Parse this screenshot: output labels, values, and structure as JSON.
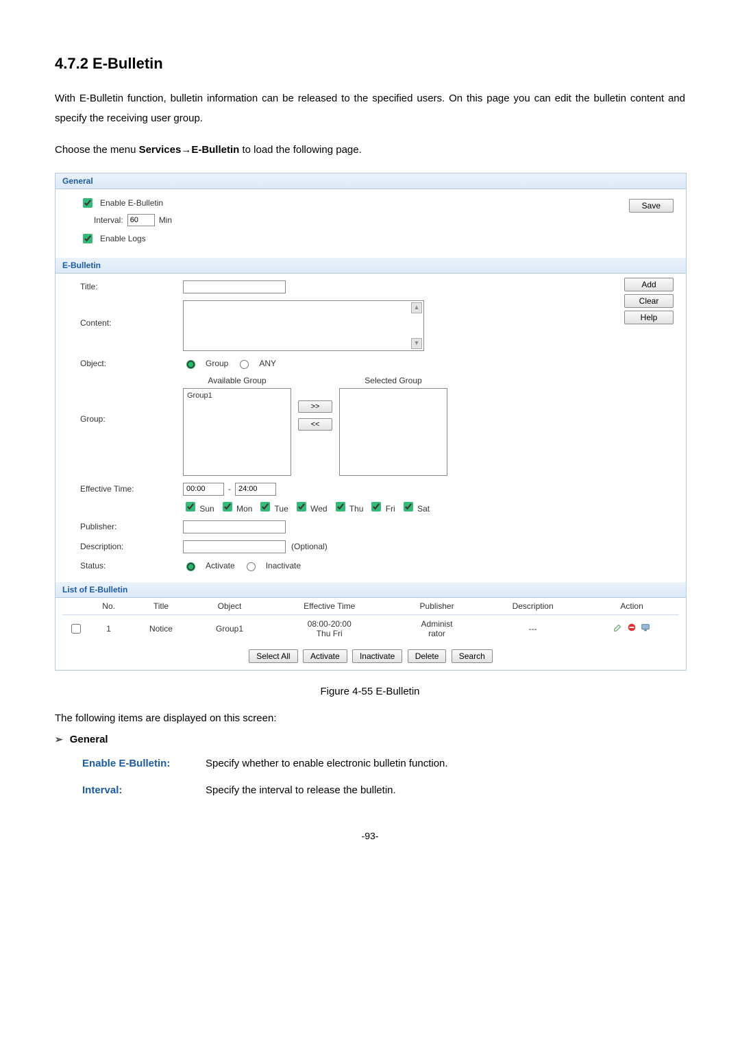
{
  "heading": "4.7.2   E-Bulletin",
  "intro": "With E-Bulletin function, bulletin information can be released to the specified users. On this page you can edit the bulletin content and specify the receiving user group.",
  "menuLine": {
    "prefix": "Choose the menu ",
    "part1": "Services",
    "arrow": "→",
    "part2": "E-Bulletin",
    "suffix": " to load the following page."
  },
  "sections": {
    "general": "General",
    "ebulletin": "E-Bulletin",
    "list": "List of E-Bulletin"
  },
  "general": {
    "enableBulletin": "Enable E-Bulletin",
    "intervalLabel": "Interval:",
    "intervalValue": "60",
    "intervalUnit": "Min",
    "enableLogs": "Enable Logs",
    "saveBtn": "Save"
  },
  "form": {
    "titleLabel": "Title:",
    "contentLabel": "Content:",
    "objectLabel": "Object:",
    "groupLabel": "Group:",
    "effectiveLabel": "Effective Time:",
    "publisherLabel": "Publisher:",
    "descriptionLabel": "Description:",
    "statusLabel": "Status:",
    "objectGroup": "Group",
    "objectAny": "ANY",
    "availableGroup": "Available Group",
    "selectedGroup": "Selected Group",
    "availItems": [
      "Group1"
    ],
    "moveRight": ">>",
    "moveLeft": "<<",
    "timeFrom": "00:00",
    "timeDash": "-",
    "timeTo": "24:00",
    "days": [
      "Sun",
      "Mon",
      "Tue",
      "Wed",
      "Thu",
      "Fri",
      "Sat"
    ],
    "optionalNote": "(Optional)",
    "statusActivate": "Activate",
    "statusInactivate": "Inactivate",
    "addBtn": "Add",
    "clearBtn": "Clear",
    "helpBtn": "Help"
  },
  "table": {
    "cols": [
      "No.",
      "Title",
      "Object",
      "Effective Time",
      "Publisher",
      "Description",
      "Action"
    ],
    "row": {
      "no": "1",
      "title": "Notice",
      "object": "Group1",
      "effTimeLine1": "08:00-20:00",
      "effTimeLine2": "Thu Fri",
      "publisherLine1": "Administ",
      "publisherLine2": "rator",
      "description": "---"
    },
    "btns": {
      "selectAll": "Select All",
      "activate": "Activate",
      "inactivate": "Inactivate",
      "delete": "Delete",
      "search": "Search"
    }
  },
  "figureCaption": "Figure 4-55 E-Bulletin",
  "descLine": "The following items are displayed on this screen:",
  "bulletGeneral": "General",
  "defs": {
    "enableTerm": "Enable E-Bulletin:",
    "enableText": "Specify whether to enable electronic bulletin function.",
    "intervalTerm": "Interval:",
    "intervalText": "Specify the interval to release the bulletin."
  },
  "pageNum": "-93-"
}
